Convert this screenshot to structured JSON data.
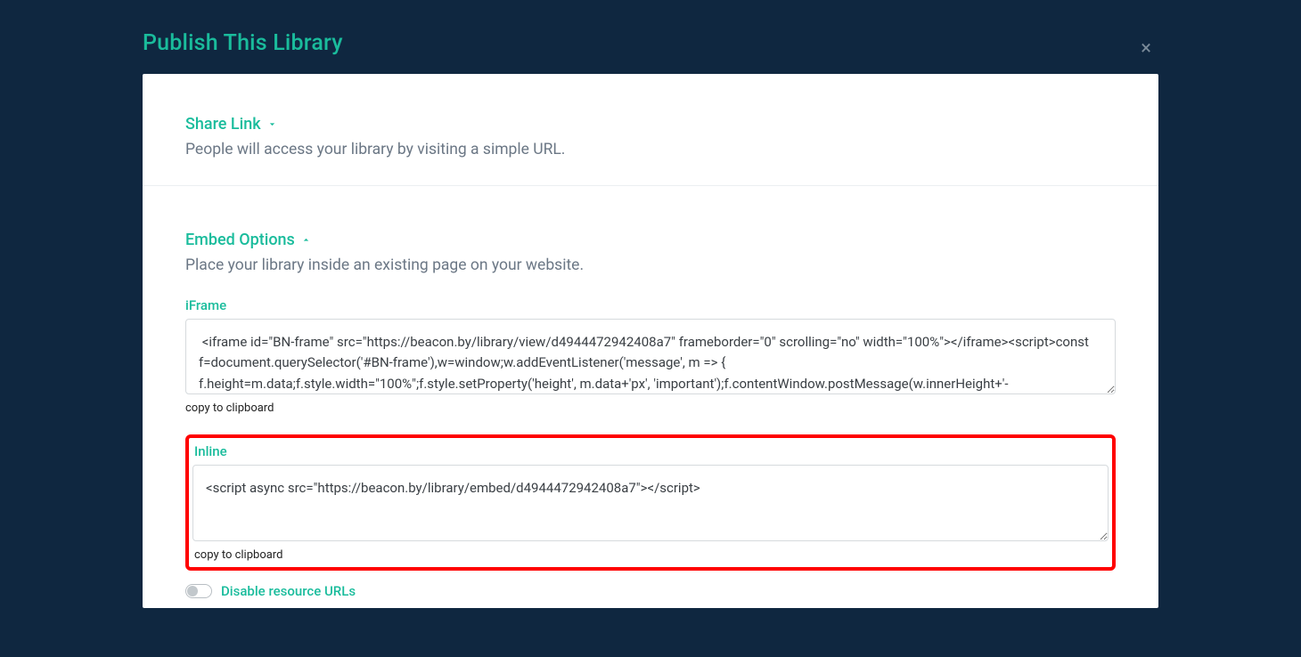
{
  "modal": {
    "title": "Publish This Library",
    "close_label": "×"
  },
  "share_link": {
    "title": "Share Link",
    "description": "People will access your library by visiting a simple URL."
  },
  "embed_options": {
    "title": "Embed Options",
    "description": "Place your library inside an existing page on your website.",
    "iframe": {
      "label": "iFrame",
      "code": " <iframe id=\"BN-frame\" src=\"https://beacon.by/library/view/d4944472942408a7\" frameborder=\"0\" scrolling=\"no\" width=\"100%\"></iframe><script>const f=document.querySelector('#BN-frame'),w=window;w.addEventListener('message', m => { f.height=m.data;f.style.width=\"100%\";f.style.setProperty('height', m.data+'px', 'important');f.contentWindow.postMessage(w.innerHeight+'-",
      "copy_label": "copy to clipboard"
    },
    "inline": {
      "label": "Inline",
      "code": "<script async src=\"https://beacon.by/library/embed/d4944472942408a7\"></script>",
      "copy_label": "copy to clipboard"
    },
    "disable_urls_label": "Disable resource URLs"
  }
}
